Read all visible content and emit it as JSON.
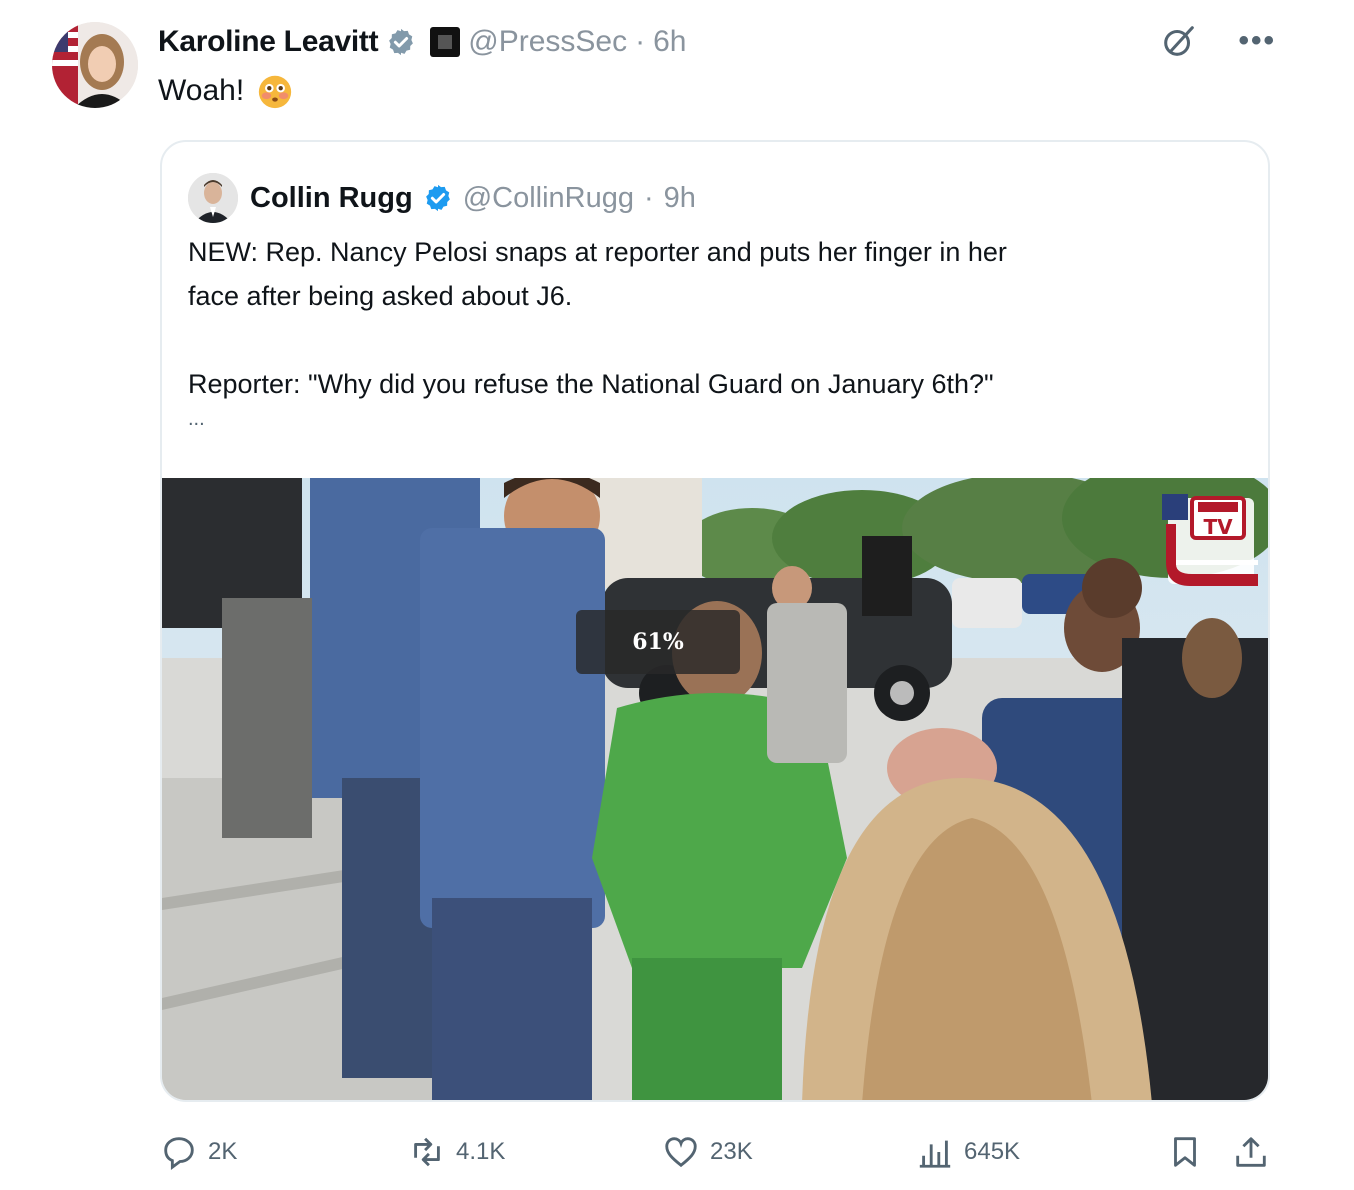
{
  "author": {
    "name": "Karoline Leavitt",
    "handle": "@PressSec",
    "separator": "·",
    "time": "6h",
    "text": "Woah!"
  },
  "quoted": {
    "name": "Collin Rugg",
    "handle": "@CollinRugg",
    "separator": "·",
    "time": "9h",
    "lines": [
      "NEW: Rep. Nancy Pelosi snaps at reporter and puts her finger in her",
      "face after being asked about J6.",
      "Reporter: \"Why did you refuse the National Guard on January 6th?\""
    ],
    "more": "..."
  },
  "media": {
    "progress_text": "61%",
    "progress_value": 61,
    "logo_text": "TV"
  },
  "actions": {
    "replies": "2K",
    "reposts": "4.1K",
    "likes": "23K",
    "views": "645K"
  },
  "icons": {
    "verified": "verified-badge-icon",
    "grok": "grok-icon",
    "more": "more-dots-icon",
    "reply": "reply-icon",
    "repost": "repost-icon",
    "like": "heart-icon",
    "views": "views-icon",
    "bookmark": "bookmark-icon",
    "share": "share-icon"
  },
  "colors": {
    "verified_blue": "#1d9bf0",
    "text": "#0f1419",
    "muted": "#8a949e"
  }
}
